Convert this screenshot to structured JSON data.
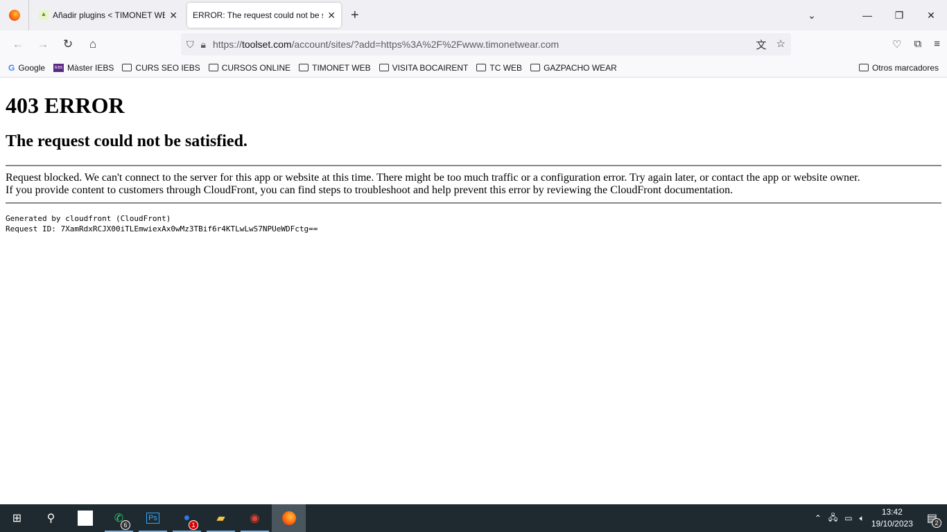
{
  "tabs": [
    {
      "label": "Añadir plugins < TIMONET WEAR",
      "active": false
    },
    {
      "label": "ERROR: The request could not be satisfied",
      "active": true
    }
  ],
  "url": {
    "prefix": "https://",
    "domain": "toolset.com",
    "path": "/account/sites/?add=https%3A%2F%2Fwww.timonetwear.com"
  },
  "bookmarks": [
    "Google",
    "Màster IEBS",
    "CURS SEO IEBS",
    "CURSOS ONLINE",
    "TIMONET WEB",
    "VISITA BOCAIRENT",
    "TC WEB",
    "GAZPACHO WEAR"
  ],
  "other_bookmarks": "Otros marcadores",
  "page": {
    "h1": "403 ERROR",
    "h2": "The request could not be satisfied.",
    "line1": "Request blocked. We can't connect to the server for this app or website at this time. There might be too much traffic or a configuration error. Try again later, or contact the app or website owner.",
    "line2": "If you provide content to customers through CloudFront, you can find steps to troubleshoot and help prevent this error by reviewing the CloudFront documentation.",
    "generated": "Generated by cloudfront (CloudFront)",
    "request_id": "Request ID: 7XamRdxRCJX00iTLEmwiexAx0wMz3TBif6r4KTLwLwS7NPUeWDFctg=="
  },
  "taskbar": {
    "whatsapp_badge": "6",
    "thunderbird_badge": "1",
    "time": "13:42",
    "date": "19/10/2023",
    "notifications": "2"
  }
}
